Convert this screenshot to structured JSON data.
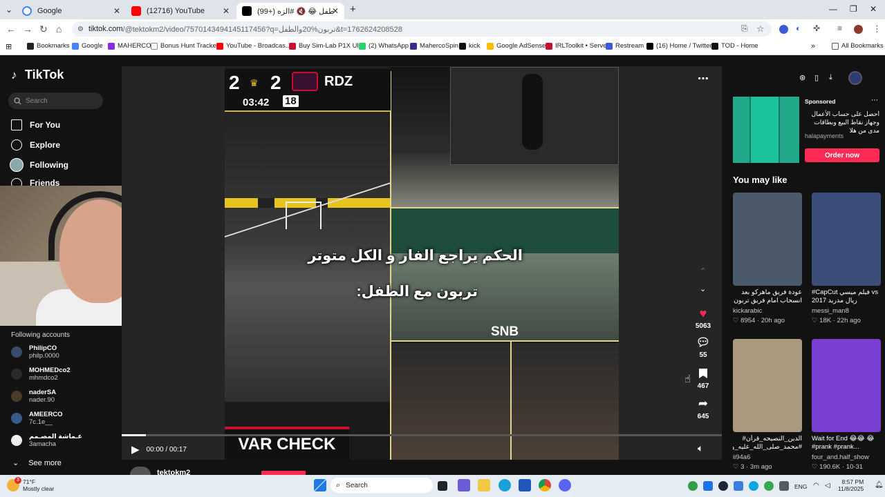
{
  "browser": {
    "tabs": [
      {
        "title": "Google",
        "active": false,
        "color": "#4285f4"
      },
      {
        "title": "(12716) YouTube",
        "active": false,
        "color": "#ff0000"
      },
      {
        "title": "(99+) يا طفل 😂 🔇 #الزه",
        "active": true,
        "color": "#000000"
      }
    ],
    "new_tab": "+",
    "url_main": "tiktok.com",
    "url_rest": "/@tektokm2/video/7570143494145117456?q=تربون%20والطفل&t=1762624208528",
    "bookmarks": [
      {
        "label": "Bookmarks",
        "color": "#222222"
      },
      {
        "label": "Google",
        "color": "#4285f4"
      },
      {
        "label": "MAHERCO",
        "color": "#8a2be2"
      },
      {
        "label": "Bonus Hunt Tracker",
        "color": "#ffffff"
      },
      {
        "label": "YouTube - Broadcas...",
        "color": "#ff0000"
      },
      {
        "label": "Buy Sim-Lab P1X Ul...",
        "color": "#c8102e"
      },
      {
        "label": "(2) WhatsApp",
        "color": "#25d366"
      },
      {
        "label": "MahercoSpin",
        "color": "#3b2a8a"
      },
      {
        "label": "kick",
        "color": "#111111"
      },
      {
        "label": "Google AdSense",
        "color": "#fbbc04"
      },
      {
        "label": "IRLToolkit • Server",
        "color": "#c8102e"
      },
      {
        "label": "Restream",
        "color": "#3b5bdb"
      },
      {
        "label": "(16) Home / Twitter",
        "color": "#000000"
      },
      {
        "label": "TOD - Home",
        "color": "#111111"
      }
    ],
    "all_bookmarks": "All Bookmarks"
  },
  "tiktok": {
    "logo": "TikTok",
    "search_placeholder": "Search",
    "nav": [
      "For You",
      "Explore",
      "Following",
      "Friends"
    ],
    "following_title": "Following accounts",
    "accounts": [
      {
        "name": "PhilipCO",
        "handle": "philp.0000"
      },
      {
        "name": "MOHMEDco2",
        "handle": "mhmdco2"
      },
      {
        "name": "naderSA",
        "handle": "nader.90"
      },
      {
        "name": "AMEERCO",
        "handle": "7c.1e__"
      },
      {
        "name": "عـماشة المصـمم",
        "handle": "3amacha"
      }
    ],
    "see_more": "See more",
    "video": {
      "score_left": "2",
      "score_right": "2",
      "team": "RDZ",
      "clock": "03:42",
      "round": "18",
      "caption_1": "الحكم يراجع الفار و الكل متوتر",
      "caption_2": "تربون مع الطفل:",
      "snb": "SNB",
      "var_check": "VAR CHECK",
      "time": "00:00 / 00:17",
      "progress": 0.04,
      "author": "tektokm2"
    },
    "actions": {
      "likes": "5063",
      "comments": "55",
      "saves": "467",
      "shares": "645"
    },
    "sponsored": {
      "tag": "Sponsored",
      "text": "احصل على حساب الأعمال وجهاز نقاط البيع وبطاقات مدى من هلا",
      "brand": "halapayments",
      "button": "Order now"
    },
    "you_may_like": "You may like",
    "cards": [
      {
        "title": "عودة فريق ماهركو بعد انسحاب امام فريق تربون في",
        "author": "kickarabic",
        "likes": "8954",
        "age": "20h ago",
        "color": "#4a5a6a"
      },
      {
        "title": "#CapCut فيلم ميسي vs ريال مدريد 2017",
        "author": "messi_man8",
        "likes": "18K",
        "age": "22h ago",
        "color": "#3b4e7a"
      },
      {
        "title": "الدين_النصيحه_قرأن# #محمد_صلى_الله_عليه_وسلم",
        "author": "ii94a6",
        "likes": "3",
        "age": "3m ago",
        "color": "#a99a7d"
      },
      {
        "title": "Wait for End 😂😂 😂#prank #prank...",
        "author": "four_and.half_show",
        "likes": "190.6K",
        "age": "10-31",
        "color": "#7a3fd0"
      }
    ]
  },
  "taskbar": {
    "temp": "71°F",
    "weather": "Mostly clear",
    "badge": "3",
    "search": "Search",
    "lang": "ENG",
    "time": "8:57 PM",
    "date": "11/8/2025"
  }
}
